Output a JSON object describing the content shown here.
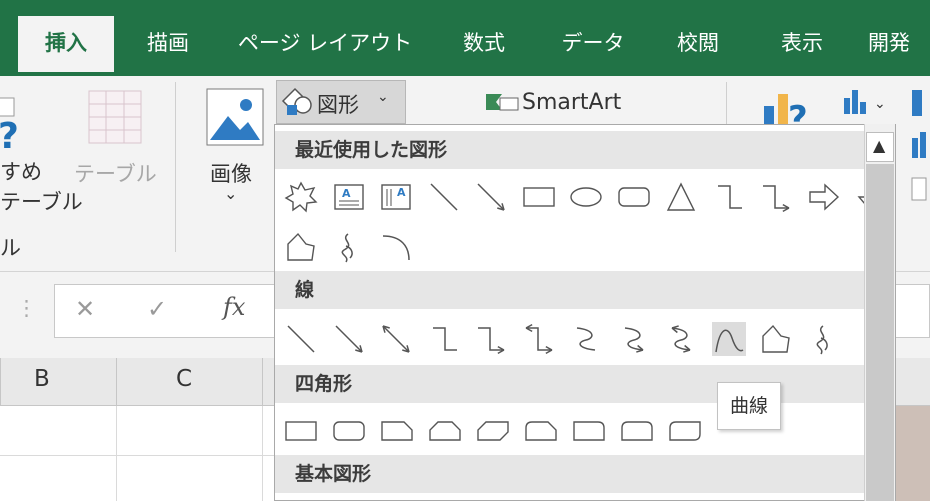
{
  "colors": {
    "accent": "#217346",
    "ribbon_bg": "#f3f3f3"
  },
  "tabs": [
    {
      "label": "挿入",
      "active": true
    },
    {
      "label": "描画"
    },
    {
      "label": "ページ レイアウト"
    },
    {
      "label": "数式"
    },
    {
      "label": "データ"
    },
    {
      "label": "校閲"
    },
    {
      "label": "表示"
    },
    {
      "label": "開発"
    }
  ],
  "ribbon": {
    "recommended_pivot_label_1": "すめ",
    "recommended_pivot_label_2": "テーブル",
    "recommended_pivot_label_3": "ル",
    "table_label": "テーブル",
    "image_label": "画像",
    "shapes_label": "図形",
    "smartart_label": "SmartArt"
  },
  "formula_bar": {
    "fx_label": "fx"
  },
  "columns": [
    "B",
    "C"
  ],
  "shapes_menu": {
    "recent_heading": "最近使用した図形",
    "lines_heading": "線",
    "rect_heading": "四角形",
    "basic_heading": "基本図形",
    "recent_icons": [
      "explosion-icon",
      "text-box-icon",
      "vertical-text-box-icon",
      "line-icon",
      "arrow-line-icon",
      "rectangle-icon",
      "oval-icon",
      "rounded-rectangle-icon",
      "triangle-icon",
      "elbow-connector-icon",
      "elbow-arrow-connector-icon",
      "right-arrow-icon",
      "down-arrow-icon",
      "freeform-icon",
      "scribble-icon",
      "arc-icon"
    ],
    "line_icons": [
      "line-icon",
      "arrow-line-icon",
      "double-arrow-line-icon",
      "elbow-connector-icon",
      "elbow-arrow-connector-icon",
      "elbow-double-arrow-connector-icon",
      "curved-connector-icon",
      "curved-arrow-connector-icon",
      "curved-double-arrow-connector-icon",
      "curve-icon",
      "freeform-icon",
      "scribble-icon"
    ],
    "rect_icons": [
      "rectangle-icon",
      "rounded-rectangle-icon",
      "snip-single-corner-rectangle-icon",
      "snip-same-side-corner-rectangle-icon",
      "snip-diagonal-corner-rectangle-icon",
      "snip-round-rectangle-icon",
      "round-single-corner-rectangle-icon",
      "round-same-side-corner-rectangle-icon",
      "round-diagonal-corner-rectangle-icon"
    ]
  },
  "tooltip": "曲線"
}
